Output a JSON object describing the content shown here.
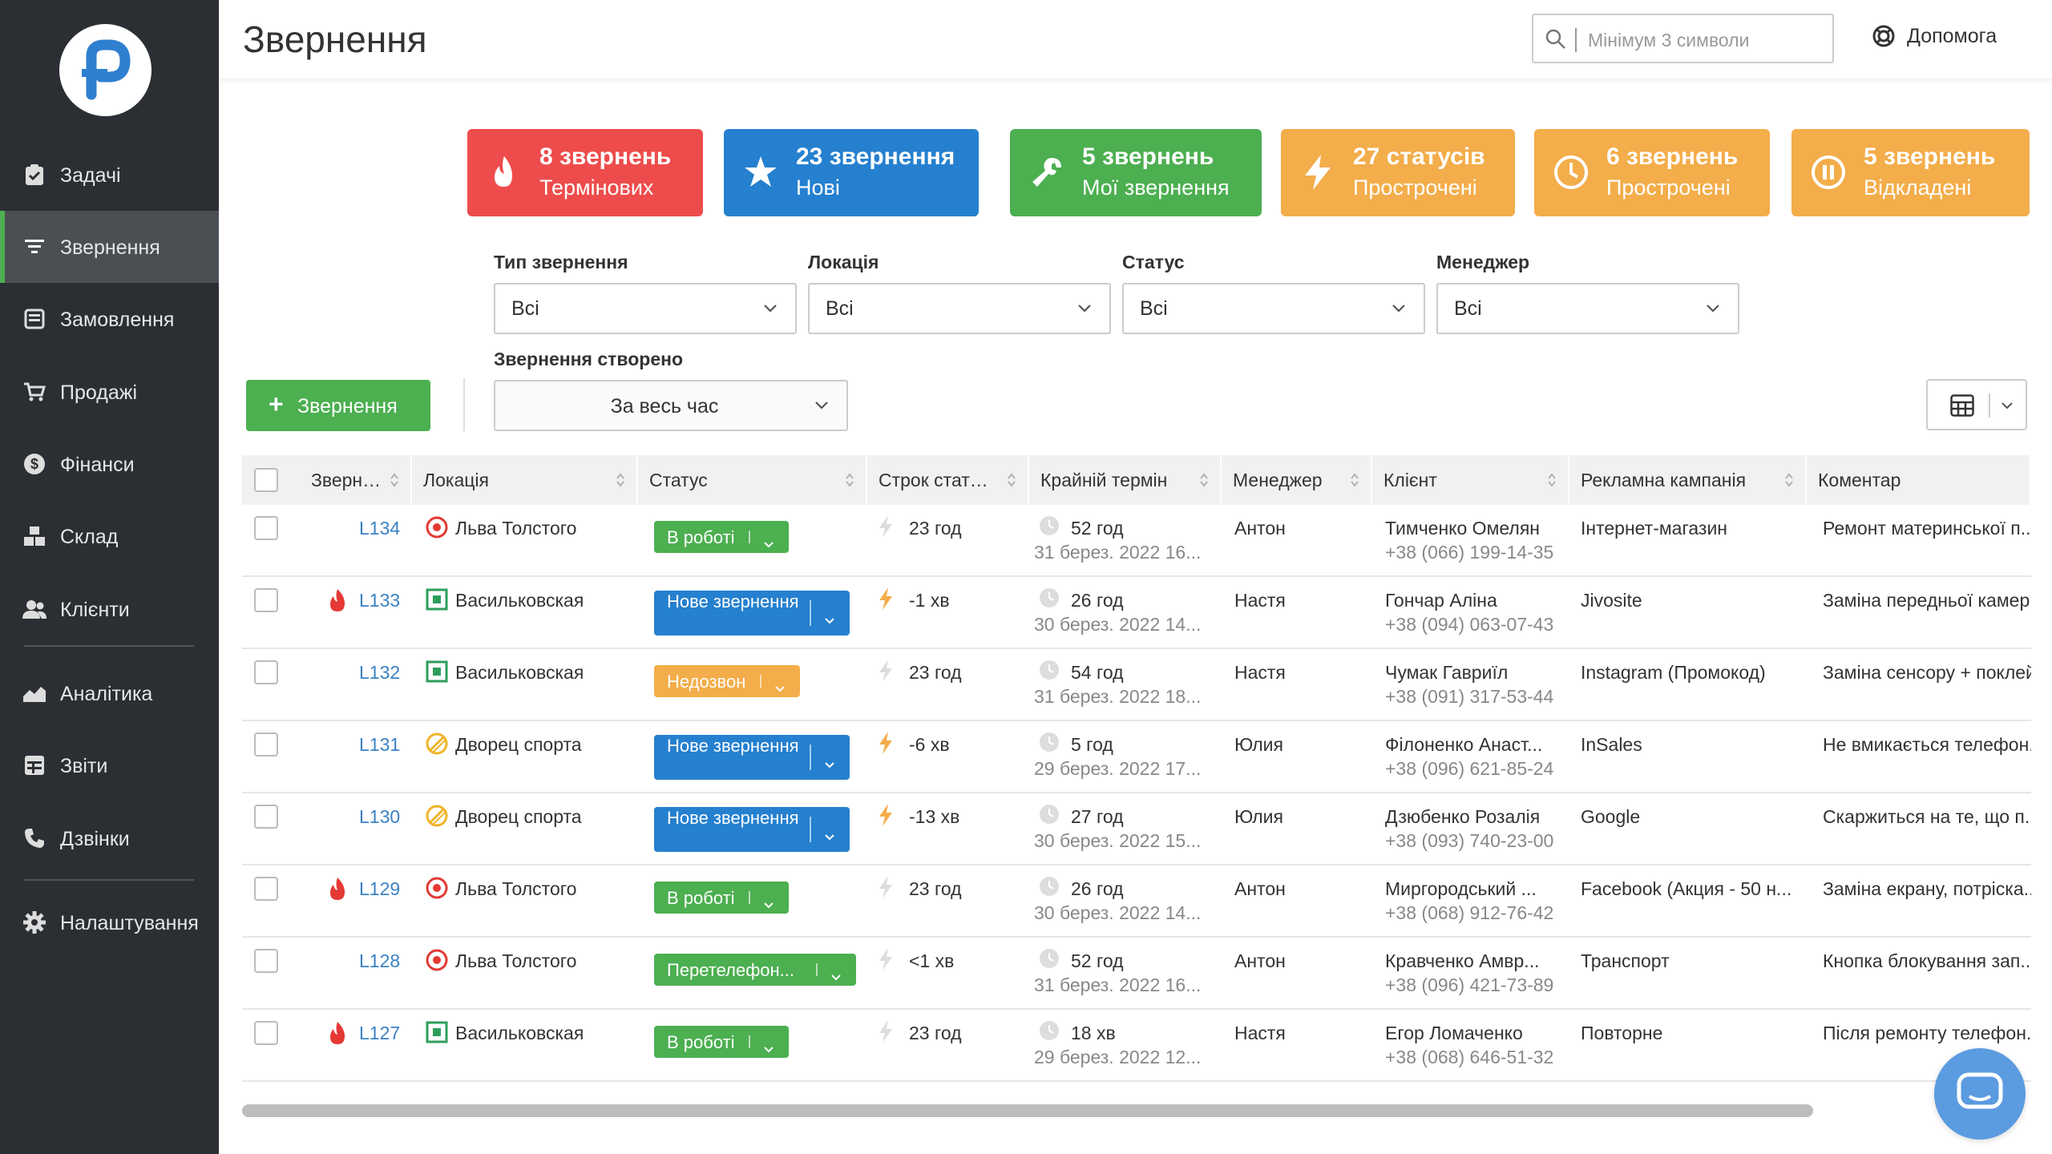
{
  "app": {
    "title": "Звернення"
  },
  "search": {
    "placeholder": "Мінімум 3 символи"
  },
  "help": {
    "label": "Допомога"
  },
  "sidebar": {
    "items": [
      {
        "label": "Задачі",
        "icon": "clipboard-check-icon"
      },
      {
        "label": "Звернення",
        "icon": "filter-icon",
        "active": true
      },
      {
        "label": "Замовлення",
        "icon": "inbox-icon"
      },
      {
        "label": "Продажі",
        "icon": "cart-icon"
      },
      {
        "label": "Фінанси",
        "icon": "dollar-icon"
      },
      {
        "label": "Склад",
        "icon": "boxes-icon"
      },
      {
        "label": "Клієнти",
        "icon": "users-icon"
      },
      {
        "label": "Аналітика",
        "icon": "area-chart-icon"
      },
      {
        "label": "Звіти",
        "icon": "table-icon"
      },
      {
        "label": "Дзвінки",
        "icon": "phone-icon"
      },
      {
        "label": "Налаштування",
        "icon": "gear-icon"
      }
    ]
  },
  "cards": [
    {
      "count": "8 звернень",
      "label": "Термінових",
      "color": "#ee4c4c",
      "icon": "fire-icon"
    },
    {
      "count": "23 звернення",
      "label": "Нові",
      "color": "#2580cf",
      "icon": "star-icon"
    },
    {
      "count": "5 звернень",
      "label": "Мої звернення",
      "color": "#4caf50",
      "icon": "wrench-icon"
    },
    {
      "count": "27 статусів",
      "label": "Прострочені",
      "color": "#f3ad4a",
      "icon": "bolt-icon"
    },
    {
      "count": "6 звернень",
      "label": "Прострочені",
      "color": "#f3ad4a",
      "icon": "clock-icon"
    },
    {
      "count": "5 звернень",
      "label": "Відкладені",
      "color": "#f3ad4a",
      "icon": "pause-icon"
    }
  ],
  "filters": {
    "type": {
      "label": "Тип звернення",
      "value": "Всі"
    },
    "location": {
      "label": "Локація",
      "value": "Всі"
    },
    "status": {
      "label": "Статус",
      "value": "Всі"
    },
    "manager": {
      "label": "Менеджер",
      "value": "Всі"
    },
    "created": {
      "label": "Звернення створено",
      "value": "За весь час"
    }
  },
  "add_button": {
    "label": "Звернення"
  },
  "table": {
    "columns": [
      "Зверн…",
      "Локація",
      "Статус",
      "Строк стат…",
      "Крайній термін",
      "Менеджер",
      "Клієнт",
      "Рекламна кампанія",
      "Коментар"
    ],
    "rows": [
      {
        "id": "L134",
        "urgent": false,
        "loc": "Льва Толстого",
        "loc_icon": "target-icon",
        "status": "В роботі",
        "status_color": "#4caf50",
        "status_lines": 1,
        "term": "23 год",
        "term_over": false,
        "deadline": "52 год",
        "deadline_date": "31 берез. 2022 16...",
        "manager": "Антон",
        "client": "Тимченко Омелян",
        "phone": "+38 (066) 199-14-35",
        "campaign": "Інтернет-магазин",
        "comment": "Ремонт материнської п..."
      },
      {
        "id": "L133",
        "urgent": true,
        "loc": "Васильковская",
        "loc_icon": "square-icon",
        "status": "Нове звернення",
        "status_color": "#2580cf",
        "status_lines": 2,
        "term": "-1 хв",
        "term_over": true,
        "deadline": "26 год",
        "deadline_date": "30 берез. 2022 14...",
        "manager": "Настя",
        "client": "Гончар Аліна",
        "phone": "+38 (094) 063-07-43",
        "campaign": "Jivosite",
        "comment": "Заміна передньої камер..."
      },
      {
        "id": "L132",
        "urgent": false,
        "loc": "Васильковская",
        "loc_icon": "square-icon",
        "status": "Недозвон",
        "status_color": "#f3ad4a",
        "status_lines": 1,
        "term": "23 год",
        "term_over": false,
        "deadline": "54 год",
        "deadline_date": "31 берез. 2022 18...",
        "manager": "Настя",
        "client": "Чумак Гавриїл",
        "phone": "+38 (091) 317-53-44",
        "campaign": "Instagram (Промокод)",
        "comment": "Заміна сенсору + поклей..."
      },
      {
        "id": "L131",
        "urgent": false,
        "loc": "Дворец спорта",
        "loc_icon": "slash-circle-icon",
        "status": "Нове звернення",
        "status_color": "#2580cf",
        "status_lines": 2,
        "term": "-6 хв",
        "term_over": true,
        "deadline": "5 год",
        "deadline_date": "29 берез. 2022 17...",
        "manager": "Юлия",
        "client": "Філоненко Анаст...",
        "phone": "+38 (096) 621-85-24",
        "campaign": "InSales",
        "comment": "Не вмикається телефон..."
      },
      {
        "id": "L130",
        "urgent": false,
        "loc": "Дворец спорта",
        "loc_icon": "slash-circle-icon",
        "status": "Нове звернення",
        "status_color": "#2580cf",
        "status_lines": 2,
        "term": "-13 хв",
        "term_over": true,
        "deadline": "27 год",
        "deadline_date": "30 берез. 2022 15...",
        "manager": "Юлия",
        "client": "Дзюбенко Розалія",
        "phone": "+38 (093) 740-23-00",
        "campaign": "Google",
        "comment": "Скаржиться на те, що п..."
      },
      {
        "id": "L129",
        "urgent": true,
        "loc": "Льва Толстого",
        "loc_icon": "target-icon",
        "status": "В роботі",
        "status_color": "#4caf50",
        "status_lines": 1,
        "term": "23 год",
        "term_over": false,
        "deadline": "26 год",
        "deadline_date": "30 берез. 2022 14...",
        "manager": "Антон",
        "client": "Миргородський ...",
        "phone": "+38 (068) 912-76-42",
        "campaign": "Facebook (Акция - 50 н...",
        "comment": "Заміна екрану, потріска..."
      },
      {
        "id": "L128",
        "urgent": false,
        "loc": "Льва Толстого",
        "loc_icon": "target-icon",
        "status": "Перетелефон...",
        "status_color": "#4caf50",
        "status_lines": 1,
        "term": "<1 хв",
        "term_over": false,
        "deadline": "52 год",
        "deadline_date": "31 берез. 2022 16...",
        "manager": "Антон",
        "client": "Кравченко Амвр...",
        "phone": "+38 (096) 421-73-89",
        "campaign": "Транспорт",
        "comment": "Кнопка блокування зап..."
      },
      {
        "id": "L127",
        "urgent": true,
        "loc": "Васильковская",
        "loc_icon": "square-icon",
        "status": "В роботі",
        "status_color": "#4caf50",
        "status_lines": 1,
        "term": "23 год",
        "term_over": false,
        "deadline": "18 хв",
        "deadline_date": "29 берез. 2022 12...",
        "manager": "Настя",
        "client": "Егор Ломаченко",
        "phone": "+38 (068) 646-51-32",
        "campaign": "Повторне",
        "comment": "Після ремонту телефон..."
      }
    ]
  }
}
